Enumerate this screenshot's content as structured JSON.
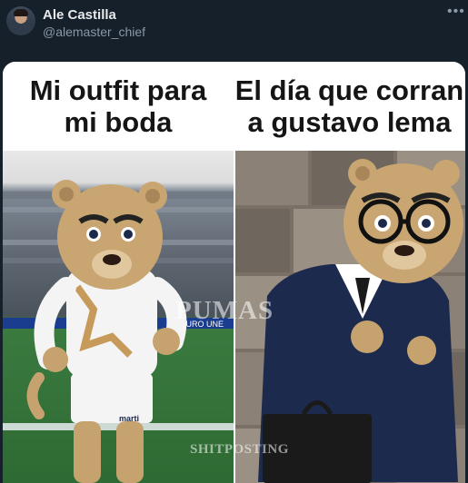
{
  "tweet": {
    "author_name": "Ale Castilla",
    "author_handle": "@alemaster_chief",
    "more_icon": "more-horizontal-icon"
  },
  "meme": {
    "left_caption": "Mi outfit para\nmi boda",
    "right_caption": "El día que corran\na gustavo lema",
    "watermark_top": "PUMAS",
    "watermark_bottom": "SHITPOSTING",
    "stadium_banner": "DURO UNE",
    "jersey_sponsor": "marti"
  },
  "colors": {
    "background": "#15202b",
    "text_primary": "#e7e9ea",
    "text_secondary": "#8b98a5"
  }
}
